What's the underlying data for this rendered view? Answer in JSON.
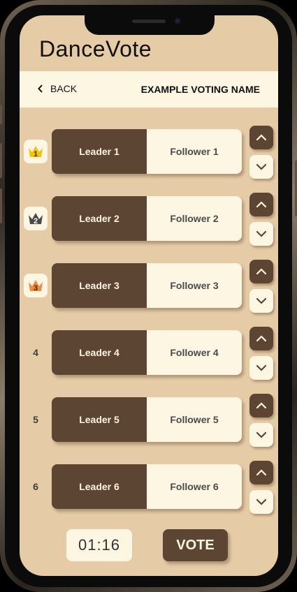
{
  "app": {
    "title": "DanceVote"
  },
  "header": {
    "back_label": "BACK",
    "voting_name": "EXAMPLE VOTING NAME"
  },
  "colors": {
    "background": "#e6cba7",
    "accent_dark": "#5c4532",
    "accent_light": "#fdf6e2",
    "gold": "#f4c20d",
    "silver": "#4a4a4a",
    "bronze": "#f08a3c"
  },
  "rankings": [
    {
      "rank": "1",
      "crown": "gold",
      "leader": "Leader 1",
      "follower": "Follower 1"
    },
    {
      "rank": "2",
      "crown": "silver",
      "leader": "Leader 2",
      "follower": "Follower 2"
    },
    {
      "rank": "3",
      "crown": "bronze",
      "leader": "Leader 3",
      "follower": "Follower 3"
    },
    {
      "rank": "4",
      "crown": null,
      "leader": "Leader 4",
      "follower": "Follower 4"
    },
    {
      "rank": "5",
      "crown": null,
      "leader": "Leader 5",
      "follower": "Follower 5"
    },
    {
      "rank": "6",
      "crown": null,
      "leader": "Leader 6",
      "follower": "Follower 6"
    }
  ],
  "footer": {
    "timer": "01:16",
    "vote_label": "VOTE"
  }
}
